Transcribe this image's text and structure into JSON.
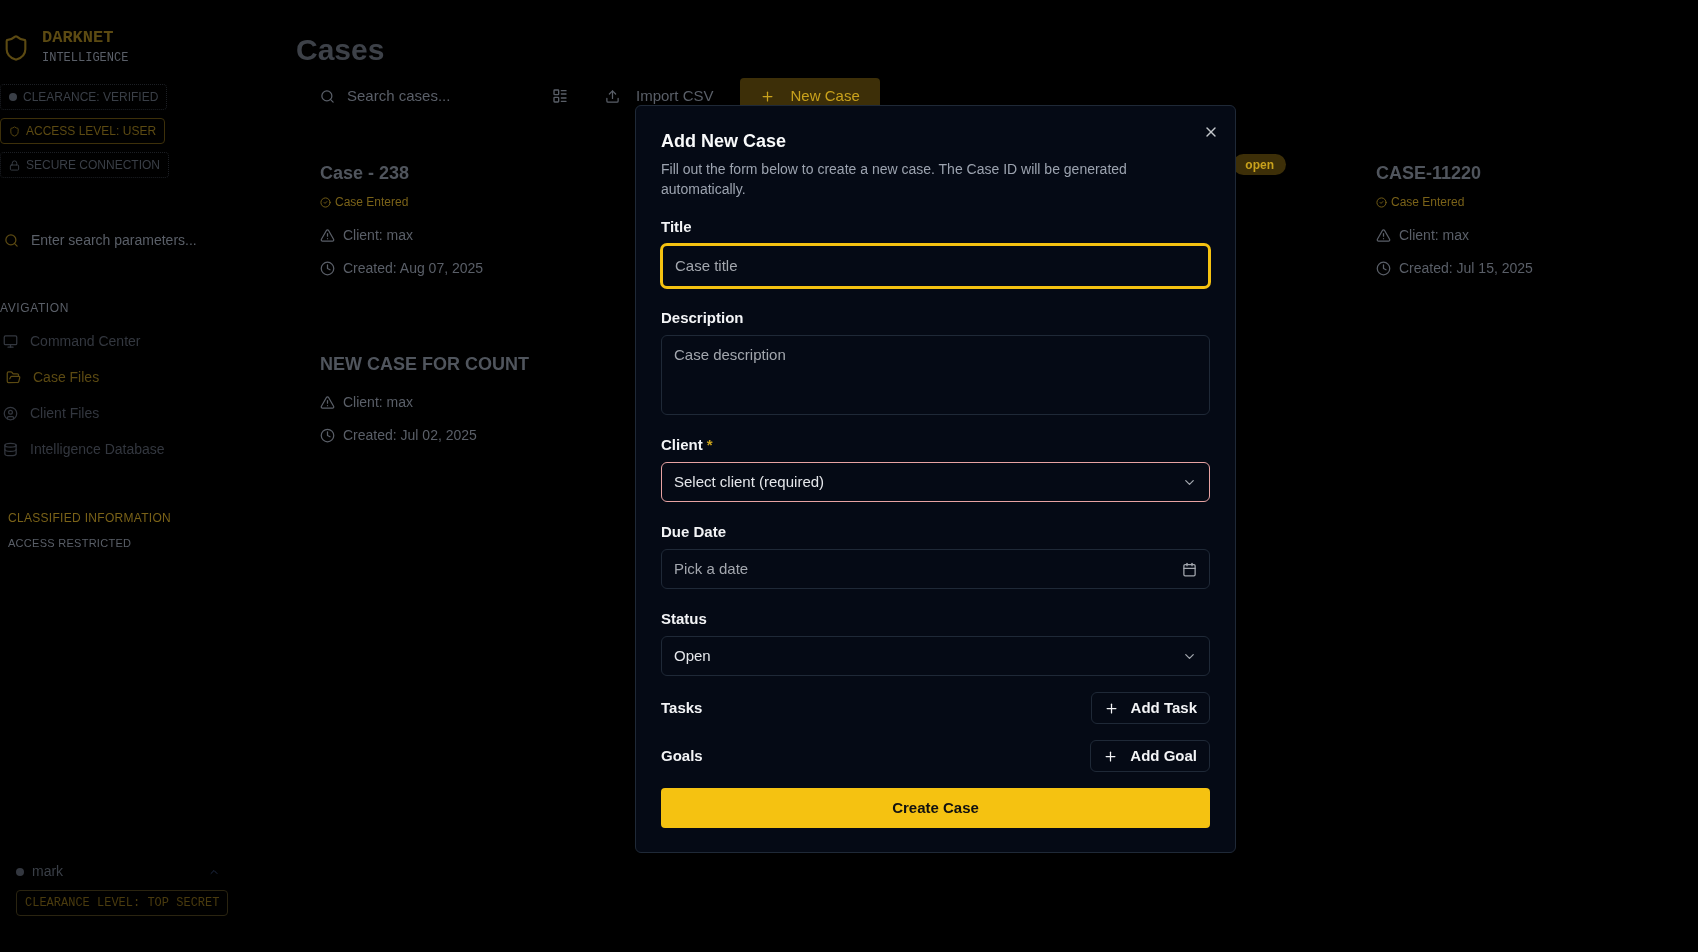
{
  "sidebar": {
    "brand": {
      "name": "DARKNET",
      "subtitle": "INTELLIGENCE"
    },
    "badges": [
      {
        "kind": "dot",
        "label": "CLEARANCE: VERIFIED",
        "highlighted": false
      },
      {
        "kind": "shield",
        "label": "ACCESS LEVEL: USER",
        "highlighted": true
      },
      {
        "kind": "lock",
        "label": "SECURE CONNECTION",
        "highlighted": false
      }
    ],
    "search": {
      "placeholder": "Enter search parameters..."
    },
    "nav_heading": "AVIGATION",
    "nav": [
      {
        "label": "Command Center",
        "selected": false
      },
      {
        "label": "Case Files",
        "selected": true
      },
      {
        "label": "Client Files",
        "selected": false
      },
      {
        "label": "Intelligence Database",
        "selected": false
      }
    ],
    "classified": {
      "title": "CLASSIFIED INFORMATION",
      "subtitle": "ACCESS RESTRICTED"
    },
    "user": {
      "name": "mark",
      "clearance": "CLEARANCE LEVEL: TOP SECRET"
    }
  },
  "main": {
    "title": "Cases",
    "search": {
      "placeholder": "Search cases..."
    },
    "import_button": "Import CSV",
    "new_button": "New Case",
    "cards": [
      {
        "title": "Case - 238",
        "status": "Case Entered",
        "client": "Client: max",
        "created": "Created: Aug 07, 2025"
      },
      {
        "badge": "open"
      },
      {
        "title": "CASE-11220",
        "status": "Case Entered",
        "client": "Client: max",
        "created": "Created: Jul 15, 2025"
      },
      {
        "title": "NEW CASE FOR COUNT",
        "client": "Client: max",
        "created": "Created: Jul 02, 2025"
      }
    ]
  },
  "modal": {
    "title": "Add New Case",
    "description": "Fill out the form below to create a new case. The Case ID will be generated automatically.",
    "fields": [
      {
        "kind": "input",
        "label": "Title",
        "placeholder": "Case title",
        "focused": true
      },
      {
        "kind": "textarea",
        "label": "Description",
        "placeholder": "Case description",
        "focused": false
      },
      {
        "kind": "select",
        "label": "Client",
        "required_mark": "*",
        "value": "Select client (required)",
        "invalid": true
      },
      {
        "kind": "date",
        "label": "Due Date",
        "placeholder": "Pick a date"
      },
      {
        "kind": "select",
        "label": "Status",
        "value": "Open",
        "invalid": false
      }
    ],
    "sections": [
      {
        "label": "Tasks",
        "button": "Add Task"
      },
      {
        "label": "Goals",
        "button": "Add Goal"
      }
    ],
    "submit": "Create Case"
  }
}
